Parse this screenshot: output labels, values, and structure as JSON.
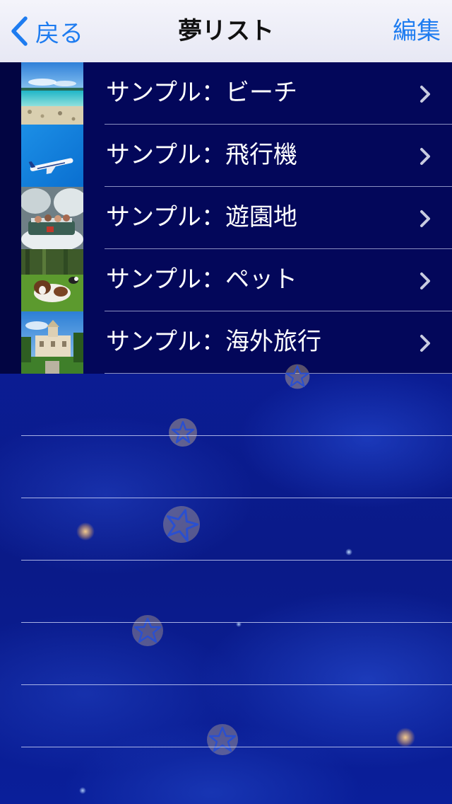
{
  "nav": {
    "back_label": "戻る",
    "title": "夢リスト",
    "edit_label": "編集"
  },
  "items": [
    {
      "label": "サンプル：ビーチ",
      "thumb": "beach-photo"
    },
    {
      "label": "サンプル：飛行機",
      "thumb": "airplane-photo"
    },
    {
      "label": "サンプル：遊園地",
      "thumb": "amusement-park-photo"
    },
    {
      "label": "サンプル：ペット",
      "thumb": "pet-dog-photo"
    },
    {
      "label": "サンプル：海外旅行",
      "thumb": "overseas-travel-photo"
    }
  ],
  "colors": {
    "accent": "#1e7cf0",
    "row_background": "#03075a",
    "background": "#0b1d96"
  }
}
